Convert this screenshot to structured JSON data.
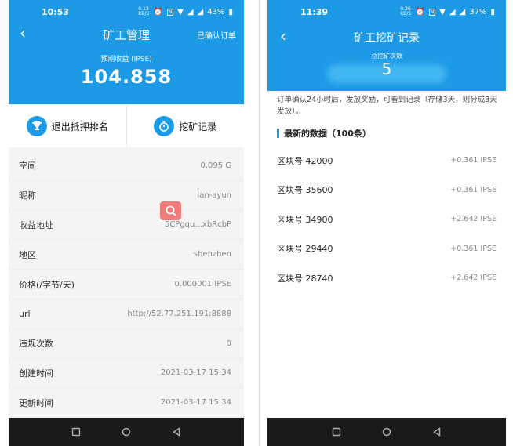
{
  "left": {
    "status": {
      "time": "10:53",
      "speed": "0.13\nKB/S",
      "battery": "43%"
    },
    "header": {
      "title": "矿工管理",
      "confirmed_orders": "已确认订单",
      "est_label": "预期收益 (IPSE)",
      "est_value": "104.858"
    },
    "actions": [
      {
        "label": "退出抵押排名",
        "icon": "trophy-icon"
      },
      {
        "label": "挖矿记录",
        "icon": "stopwatch-icon"
      }
    ],
    "details": [
      {
        "key": "空间",
        "value": "0.095 G"
      },
      {
        "key": "昵称",
        "value": "lan-ayun"
      },
      {
        "key": "收益地址",
        "value": "5CPgqu...xbRcbP"
      },
      {
        "key": "地区",
        "value": "shenzhen"
      },
      {
        "key": "价格(/字节/天)",
        "value": "0.000001 IPSE"
      },
      {
        "key": "url",
        "value": "http://52.77.251.191:8888"
      },
      {
        "key": "违规次数",
        "value": "0"
      },
      {
        "key": "创建时间",
        "value": "2021-03-17 15:34"
      },
      {
        "key": "更新时间",
        "value": "2021-03-17 15:34"
      }
    ]
  },
  "right": {
    "status": {
      "time": "11:39",
      "speed": "0.36\nKB/S",
      "battery": "37%"
    },
    "header": {
      "title": "矿工挖矿记录",
      "total_label": "总挖矿次数",
      "total_value": "5"
    },
    "note": "订单确认24小时后，发放奖励，可看到记录（存储3天，则分成3天发放）。",
    "section_title": "最新的数据（100条）",
    "records": [
      {
        "block": "区块号 42000",
        "amount": "+0.361 IPSE"
      },
      {
        "block": "区块号 35600",
        "amount": "+0.361 IPSE"
      },
      {
        "block": "区块号 34900",
        "amount": "+2.642 IPSE"
      },
      {
        "block": "区块号 29440",
        "amount": "+0.361 IPSE"
      },
      {
        "block": "区块号 28740",
        "amount": "+2.642 IPSE"
      }
    ]
  },
  "colors": {
    "accent": "#1c9ae6",
    "nav": "#1a1a1a",
    "badge": "#f07b7b"
  }
}
